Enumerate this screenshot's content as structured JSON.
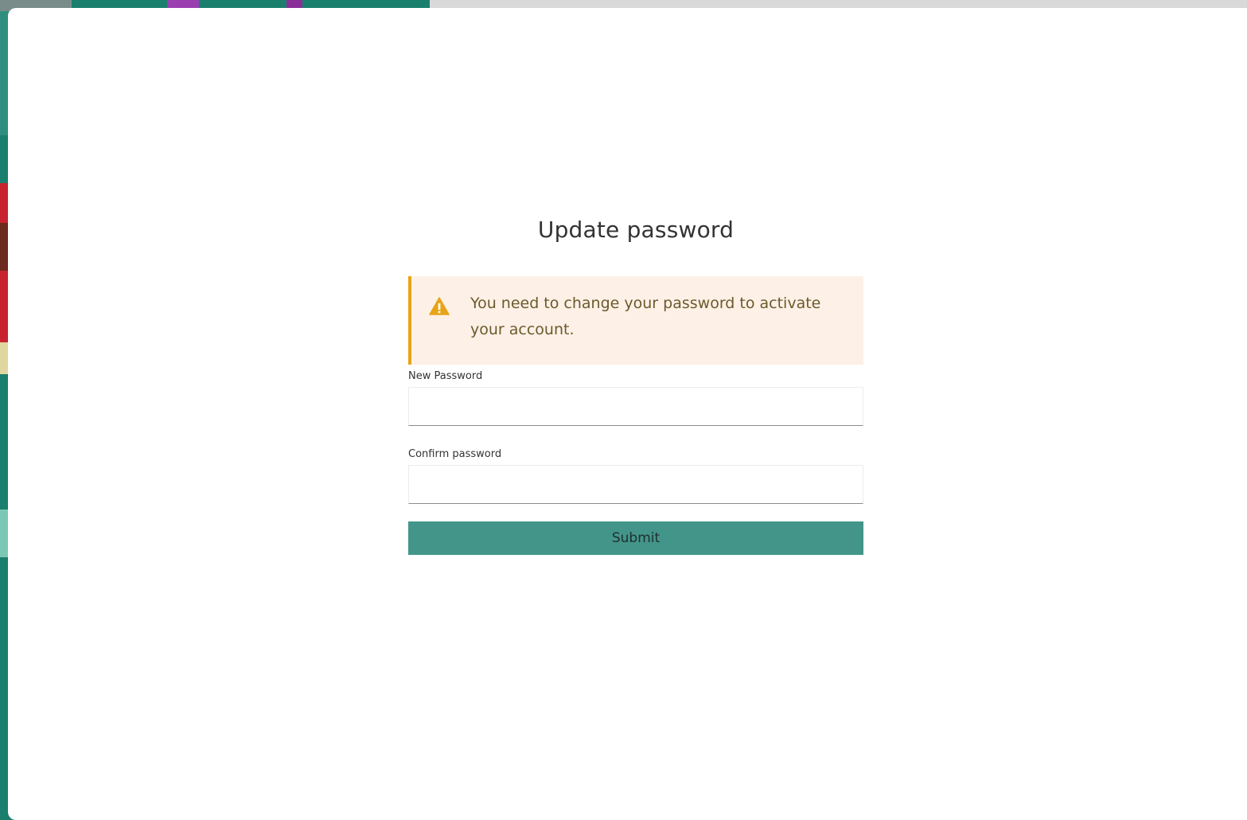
{
  "page": {
    "title": "Update password"
  },
  "alert": {
    "icon": "warning-triangle-icon",
    "message": "You need to change your password to activate your account.",
    "color": "#e8a317",
    "background": "#fdf0e6"
  },
  "form": {
    "new_password": {
      "label": "New Password",
      "value": "",
      "placeholder": ""
    },
    "confirm_password": {
      "label": "Confirm password",
      "value": "",
      "placeholder": ""
    },
    "submit_label": "Submit",
    "submit_color": "#43958a"
  }
}
